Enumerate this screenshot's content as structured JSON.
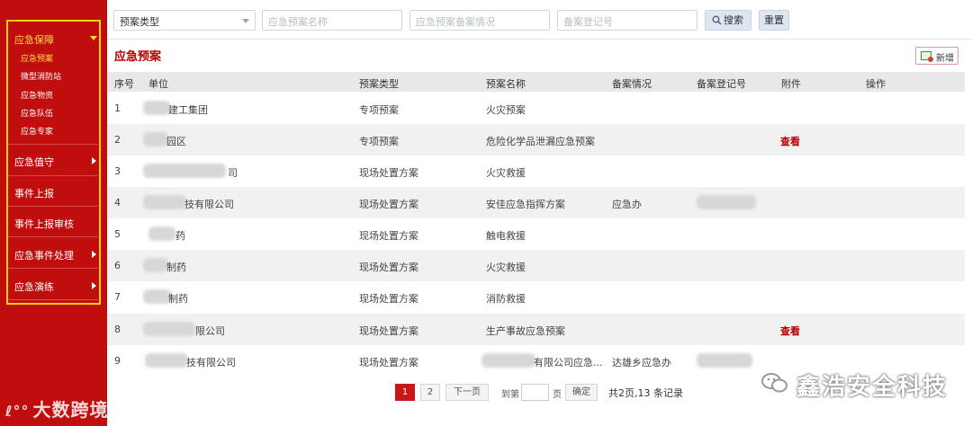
{
  "sidebar": {
    "groups": [
      {
        "label": "应急保障",
        "expanded": true,
        "subitems": [
          "应急预案",
          "微型消防站",
          "应急物资",
          "应急队伍",
          "应急专家"
        ]
      },
      {
        "label": "应急值守"
      },
      {
        "label": "事件上报"
      },
      {
        "label": "事件上报审核"
      },
      {
        "label": "应急事件处理"
      },
      {
        "label": "应急演练"
      }
    ]
  },
  "filters": {
    "type_select": "预案类型",
    "name_placeholder": "应急预案名称",
    "filing_placeholder": "应急预案备案情况",
    "regno_placeholder": "备案登记号",
    "search_label": "搜索",
    "reset_label": "重置"
  },
  "page": {
    "title": "应急预案",
    "add_label": "新增"
  },
  "table": {
    "headers": [
      "序号",
      "单位",
      "预案类型",
      "预案名称",
      "备案情况",
      "备案登记号",
      "附件",
      "操作"
    ],
    "rows": [
      {
        "no": "1",
        "unit": "建工集团",
        "type": "专项预案",
        "name": "火灾预案",
        "filing": "",
        "attach": ""
      },
      {
        "no": "2",
        "unit": "园区",
        "type": "专项预案",
        "name": "危险化学品泄漏应急预案",
        "filing": "",
        "attach": "查看"
      },
      {
        "no": "3",
        "unit": "司",
        "type": "现场处置方案",
        "name": "火灾救援",
        "filing": "",
        "attach": ""
      },
      {
        "no": "4",
        "unit": "技有限公司",
        "type": "现场处置方案",
        "name": "安佳应急指挥方案",
        "filing": "应急办",
        "attach": ""
      },
      {
        "no": "5",
        "unit": "药",
        "type": "现场处置方案",
        "name": "触电救援",
        "filing": "",
        "attach": ""
      },
      {
        "no": "6",
        "unit": "制药",
        "type": "现场处置方案",
        "name": "火灾救援",
        "filing": "",
        "attach": ""
      },
      {
        "no": "7",
        "unit": "制药",
        "type": "现场处置方案",
        "name": "消防救援",
        "filing": "",
        "attach": ""
      },
      {
        "no": "8",
        "unit": "限公司",
        "type": "现场处置方案",
        "name": "生产事故应急预案",
        "filing": "",
        "attach": "查看"
      },
      {
        "no": "9",
        "unit": "技有限公司",
        "type": "现场处置方案",
        "name": "有限公司应急...",
        "filing": "达雄乡应急办",
        "attach": ""
      }
    ]
  },
  "pagination": {
    "pages": [
      "1",
      "2"
    ],
    "current": "1",
    "next_label": "下一页",
    "goto_prefix": "到第",
    "goto_suffix": "页",
    "confirm_label": "确定",
    "total_text": "共2页,13 条记录"
  },
  "watermarks": {
    "left": "大数跨境",
    "right": "鑫浩安全科技"
  }
}
